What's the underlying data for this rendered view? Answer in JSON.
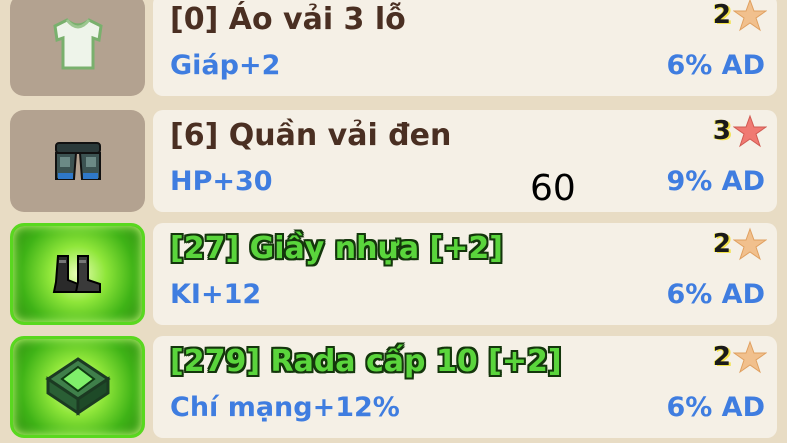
{
  "items": [
    {
      "name": "[0] Áo vải 3 lỗ",
      "stat": "Giáp+2",
      "ad": "6% AD",
      "stars": "2",
      "star_color": "#f1c08d",
      "icon": "shirt-icon",
      "rare": false
    },
    {
      "name": "[6] Quần vải đen",
      "stat": "HP+30",
      "ad": "9% AD",
      "stars": "3",
      "star_color": "#f07a72",
      "icon": "pants-icon",
      "rare": false
    },
    {
      "name": "[27] Giầy nhựa [+2]",
      "stat": "KI+12",
      "ad": "6% AD",
      "stars": "2",
      "star_color": "#f1c08d",
      "icon": "boots-icon",
      "rare": true
    },
    {
      "name": "[279] Rada cấp 10 [+2]",
      "stat": "Chí mạng+12%",
      "ad": "6% AD",
      "stars": "2",
      "star_color": "#f1c08d",
      "icon": "radar-icon",
      "rare": true
    }
  ],
  "overlay_number": "60",
  "colors": {
    "rare_glow": "#59d81f",
    "stat_blue": "#3f7de0",
    "name_brown": "#4a2f22"
  }
}
